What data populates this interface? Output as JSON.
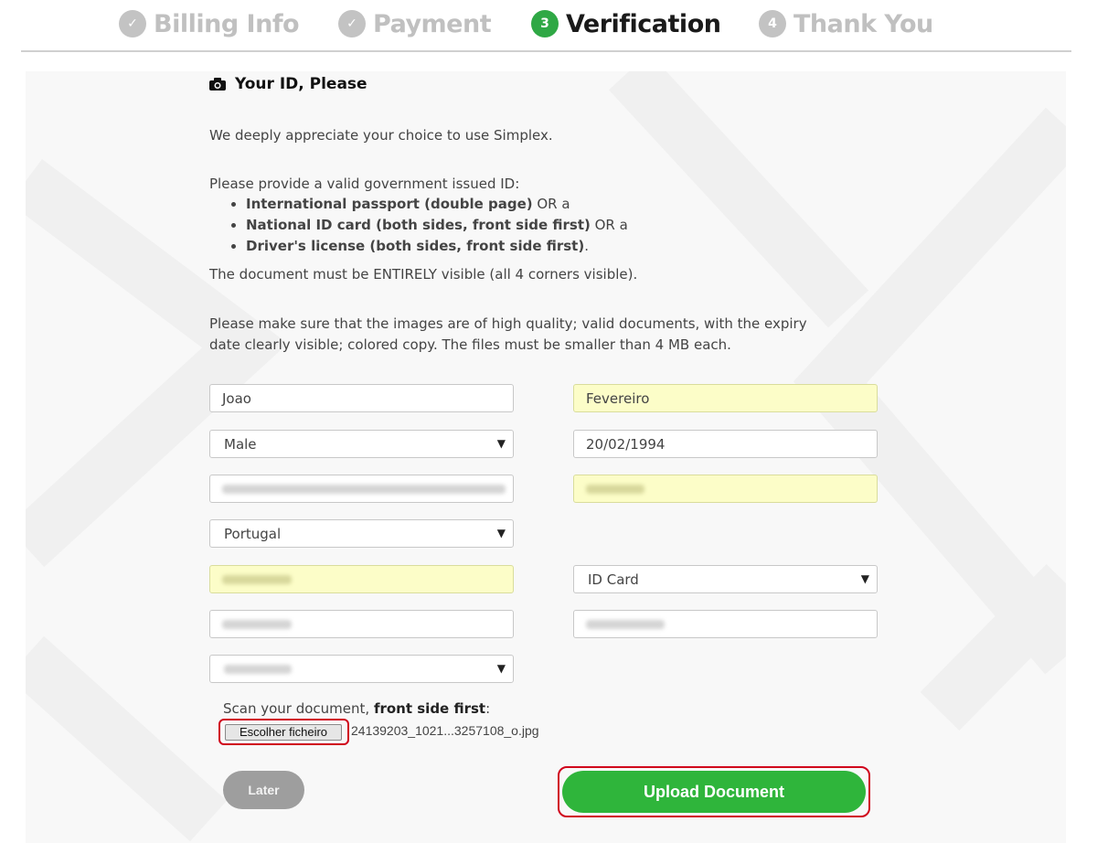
{
  "steps": [
    {
      "number": "✓",
      "label": "Billing Info",
      "state": "done"
    },
    {
      "number": "✓",
      "label": "Payment",
      "state": "done"
    },
    {
      "number": "3",
      "label": "Verification",
      "state": "active"
    },
    {
      "number": "4",
      "label": "Thank You",
      "state": "pending"
    }
  ],
  "section": {
    "title": "Your ID, Please",
    "intro": "We deeply appreciate your choice to use Simplex.",
    "provide": "Please provide a valid government issued ID:",
    "id_types": [
      {
        "bold": "International passport (double page)",
        "rest": " OR a"
      },
      {
        "bold": "National ID card (both sides, front side first)",
        "rest": " OR a"
      },
      {
        "bold": "Driver's license (both sides, front side first)",
        "rest": "."
      }
    ],
    "visibility_note": "The document must be ENTIRELY visible (all 4 corners visible).",
    "quality_line1": "Please make sure that the images are of high quality; valid documents, with the expiry",
    "quality_line2": "date clearly visible; colored copy. The files must be smaller than 4 MB each."
  },
  "form": {
    "first_name": "Joao",
    "last_name": "Fevereiro",
    "gender": "Male",
    "birth_date": "20/02/1994",
    "country": "Portugal",
    "document_type": "ID Card"
  },
  "upload": {
    "scan_prefix": "Scan your document, ",
    "scan_bold": "front side first",
    "scan_suffix": ":",
    "choose_file_label": "Escolher ficheiro",
    "file_name": "24139203_1021...3257108_o.jpg",
    "later_label": "Later",
    "upload_label": "Upload Document"
  },
  "colors": {
    "accent_green": "#2fb53b",
    "active_step": "#2fa845",
    "highlight_red": "#d0021b",
    "autofill_yellow": "#fcfdc8"
  }
}
